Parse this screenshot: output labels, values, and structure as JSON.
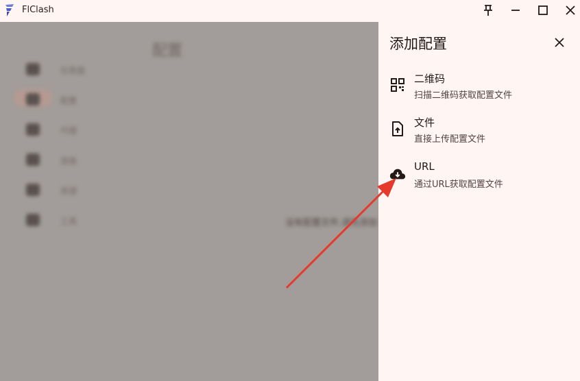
{
  "window": {
    "title": "FlClash",
    "controls": [
      "pin-icon",
      "minimize-icon",
      "maximize-icon",
      "close-icon"
    ]
  },
  "background": {
    "page_title": "配置",
    "nav_items": [
      {
        "label": "仪表盘",
        "icon": "dashboard-icon"
      },
      {
        "label": "配置",
        "icon": "folder-icon",
        "active": true
      },
      {
        "label": "代理",
        "icon": "proxy-icon"
      },
      {
        "label": "连接",
        "icon": "connection-icon"
      },
      {
        "label": "资源",
        "icon": "resource-icon"
      },
      {
        "label": "工具",
        "icon": "tools-icon"
      }
    ],
    "empty_message": "没有配置文件,请先添加"
  },
  "panel": {
    "title": "添加配置",
    "options": [
      {
        "title": "二维码",
        "subtitle": "扫描二维码获取配置文件",
        "icon": "qr-code-icon"
      },
      {
        "title": "文件",
        "subtitle": "直接上传配置文件",
        "icon": "file-upload-icon"
      },
      {
        "title": "URL",
        "subtitle": "通过URL获取配置文件",
        "icon": "cloud-download-icon"
      }
    ]
  },
  "colors": {
    "panel_bg": "#fff6f4",
    "scrim": "#a29d9a",
    "arrow": "#e53a2b"
  }
}
